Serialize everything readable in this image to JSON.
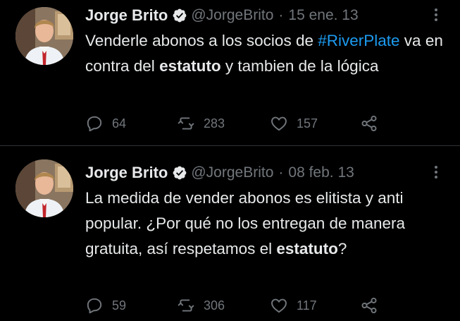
{
  "colors": {
    "background": "#000000",
    "text": "#e7e9ea",
    "muted": "#71767b",
    "link": "#1d9bf0",
    "divider": "#2f3336"
  },
  "tweets": [
    {
      "author": {
        "name": "Jorge Brito",
        "handle": "@JorgeBrito",
        "verified": true,
        "avatar_icon": "avatar-icon"
      },
      "separator": "·",
      "date": "15 ene. 13",
      "text": {
        "p1": "Venderle abonos a los socios de ",
        "hashtag": "#RiverPlate",
        "p2": " va en contra del ",
        "bold": "estatuto",
        "p3": " y tambien de la lógica"
      },
      "stats": {
        "replies": "64",
        "retweets": "283",
        "likes": "157"
      }
    },
    {
      "author": {
        "name": "Jorge Brito",
        "handle": "@JorgeBrito",
        "verified": true,
        "avatar_icon": "avatar-icon"
      },
      "separator": "·",
      "date": "08 feb. 13",
      "text": {
        "p1": "La medida de vender abonos es elitista y anti popular. ¿Por qué no los entregan de manera gratuita, así respetamos el ",
        "bold": "estatuto",
        "p2": "?"
      },
      "stats": {
        "replies": "59",
        "retweets": "306",
        "likes": "117"
      }
    }
  ]
}
